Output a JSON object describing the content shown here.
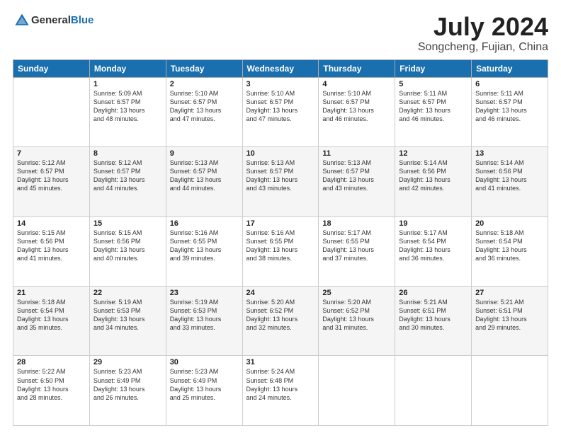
{
  "header": {
    "logo_general": "General",
    "logo_blue": "Blue",
    "month_year": "July 2024",
    "location": "Songcheng, Fujian, China"
  },
  "columns": [
    "Sunday",
    "Monday",
    "Tuesday",
    "Wednesday",
    "Thursday",
    "Friday",
    "Saturday"
  ],
  "weeks": [
    [
      {
        "day": "",
        "content": ""
      },
      {
        "day": "1",
        "content": "Sunrise: 5:09 AM\nSunset: 6:57 PM\nDaylight: 13 hours\nand 48 minutes."
      },
      {
        "day": "2",
        "content": "Sunrise: 5:10 AM\nSunset: 6:57 PM\nDaylight: 13 hours\nand 47 minutes."
      },
      {
        "day": "3",
        "content": "Sunrise: 5:10 AM\nSunset: 6:57 PM\nDaylight: 13 hours\nand 47 minutes."
      },
      {
        "day": "4",
        "content": "Sunrise: 5:10 AM\nSunset: 6:57 PM\nDaylight: 13 hours\nand 46 minutes."
      },
      {
        "day": "5",
        "content": "Sunrise: 5:11 AM\nSunset: 6:57 PM\nDaylight: 13 hours\nand 46 minutes."
      },
      {
        "day": "6",
        "content": "Sunrise: 5:11 AM\nSunset: 6:57 PM\nDaylight: 13 hours\nand 46 minutes."
      }
    ],
    [
      {
        "day": "7",
        "content": "Sunrise: 5:12 AM\nSunset: 6:57 PM\nDaylight: 13 hours\nand 45 minutes."
      },
      {
        "day": "8",
        "content": "Sunrise: 5:12 AM\nSunset: 6:57 PM\nDaylight: 13 hours\nand 44 minutes."
      },
      {
        "day": "9",
        "content": "Sunrise: 5:13 AM\nSunset: 6:57 PM\nDaylight: 13 hours\nand 44 minutes."
      },
      {
        "day": "10",
        "content": "Sunrise: 5:13 AM\nSunset: 6:57 PM\nDaylight: 13 hours\nand 43 minutes."
      },
      {
        "day": "11",
        "content": "Sunrise: 5:13 AM\nSunset: 6:57 PM\nDaylight: 13 hours\nand 43 minutes."
      },
      {
        "day": "12",
        "content": "Sunrise: 5:14 AM\nSunset: 6:56 PM\nDaylight: 13 hours\nand 42 minutes."
      },
      {
        "day": "13",
        "content": "Sunrise: 5:14 AM\nSunset: 6:56 PM\nDaylight: 13 hours\nand 41 minutes."
      }
    ],
    [
      {
        "day": "14",
        "content": "Sunrise: 5:15 AM\nSunset: 6:56 PM\nDaylight: 13 hours\nand 41 minutes."
      },
      {
        "day": "15",
        "content": "Sunrise: 5:15 AM\nSunset: 6:56 PM\nDaylight: 13 hours\nand 40 minutes."
      },
      {
        "day": "16",
        "content": "Sunrise: 5:16 AM\nSunset: 6:55 PM\nDaylight: 13 hours\nand 39 minutes."
      },
      {
        "day": "17",
        "content": "Sunrise: 5:16 AM\nSunset: 6:55 PM\nDaylight: 13 hours\nand 38 minutes."
      },
      {
        "day": "18",
        "content": "Sunrise: 5:17 AM\nSunset: 6:55 PM\nDaylight: 13 hours\nand 37 minutes."
      },
      {
        "day": "19",
        "content": "Sunrise: 5:17 AM\nSunset: 6:54 PM\nDaylight: 13 hours\nand 36 minutes."
      },
      {
        "day": "20",
        "content": "Sunrise: 5:18 AM\nSunset: 6:54 PM\nDaylight: 13 hours\nand 36 minutes."
      }
    ],
    [
      {
        "day": "21",
        "content": "Sunrise: 5:18 AM\nSunset: 6:54 PM\nDaylight: 13 hours\nand 35 minutes."
      },
      {
        "day": "22",
        "content": "Sunrise: 5:19 AM\nSunset: 6:53 PM\nDaylight: 13 hours\nand 34 minutes."
      },
      {
        "day": "23",
        "content": "Sunrise: 5:19 AM\nSunset: 6:53 PM\nDaylight: 13 hours\nand 33 minutes."
      },
      {
        "day": "24",
        "content": "Sunrise: 5:20 AM\nSunset: 6:52 PM\nDaylight: 13 hours\nand 32 minutes."
      },
      {
        "day": "25",
        "content": "Sunrise: 5:20 AM\nSunset: 6:52 PM\nDaylight: 13 hours\nand 31 minutes."
      },
      {
        "day": "26",
        "content": "Sunrise: 5:21 AM\nSunset: 6:51 PM\nDaylight: 13 hours\nand 30 minutes."
      },
      {
        "day": "27",
        "content": "Sunrise: 5:21 AM\nSunset: 6:51 PM\nDaylight: 13 hours\nand 29 minutes."
      }
    ],
    [
      {
        "day": "28",
        "content": "Sunrise: 5:22 AM\nSunset: 6:50 PM\nDaylight: 13 hours\nand 28 minutes."
      },
      {
        "day": "29",
        "content": "Sunrise: 5:23 AM\nSunset: 6:49 PM\nDaylight: 13 hours\nand 26 minutes."
      },
      {
        "day": "30",
        "content": "Sunrise: 5:23 AM\nSunset: 6:49 PM\nDaylight: 13 hours\nand 25 minutes."
      },
      {
        "day": "31",
        "content": "Sunrise: 5:24 AM\nSunset: 6:48 PM\nDaylight: 13 hours\nand 24 minutes."
      },
      {
        "day": "",
        "content": ""
      },
      {
        "day": "",
        "content": ""
      },
      {
        "day": "",
        "content": ""
      }
    ]
  ]
}
